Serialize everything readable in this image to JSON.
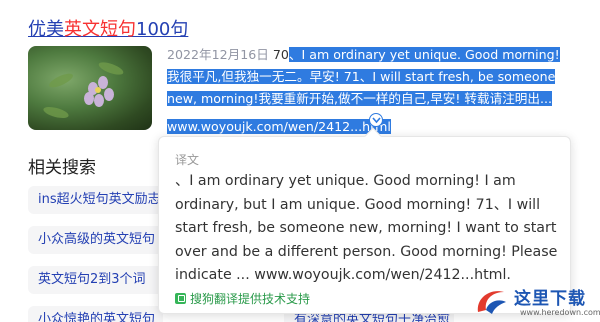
{
  "result": {
    "title_prefix": "优美",
    "title_highlight": "英文短句",
    "title_suffix": "100句",
    "date": "2022年12月16日",
    "snippet_lead": " 70",
    "snippet_selected": "、I am ordinary yet unique. Good morning!我很平凡,但我独一无二。早安! 71、I will start fresh, be someone new, morning!我要重新开始,做不一样的自己,早安! 转载请注明出...",
    "url": "www.woyoujk.com/wen/2412...html"
  },
  "translation_popup": {
    "label": "译文",
    "text": "、I am ordinary yet unique. Good morning! I am ordinary, but I am unique. Good morning! 71、I will start fresh, be someone new, morning! I want to start over and be a different person. Good morning! Please indicate ... www.woyoujk.com/wen/2412...html.",
    "footer": "搜狗翻译提供技术支持"
  },
  "related": {
    "heading": "相关搜索",
    "items": [
      "ins超火短句英文励志",
      "小众高级的英文短句",
      "英文短句2到3个词",
      "小众惊艳的英文短句",
      "有深意的英文短句干净治愈"
    ]
  },
  "watermark": {
    "name": "这里下载",
    "url": "www.heredown.com"
  },
  "colors": {
    "link": "#2440b3",
    "highlight": "#f73131",
    "selection": "#2f7be0"
  }
}
